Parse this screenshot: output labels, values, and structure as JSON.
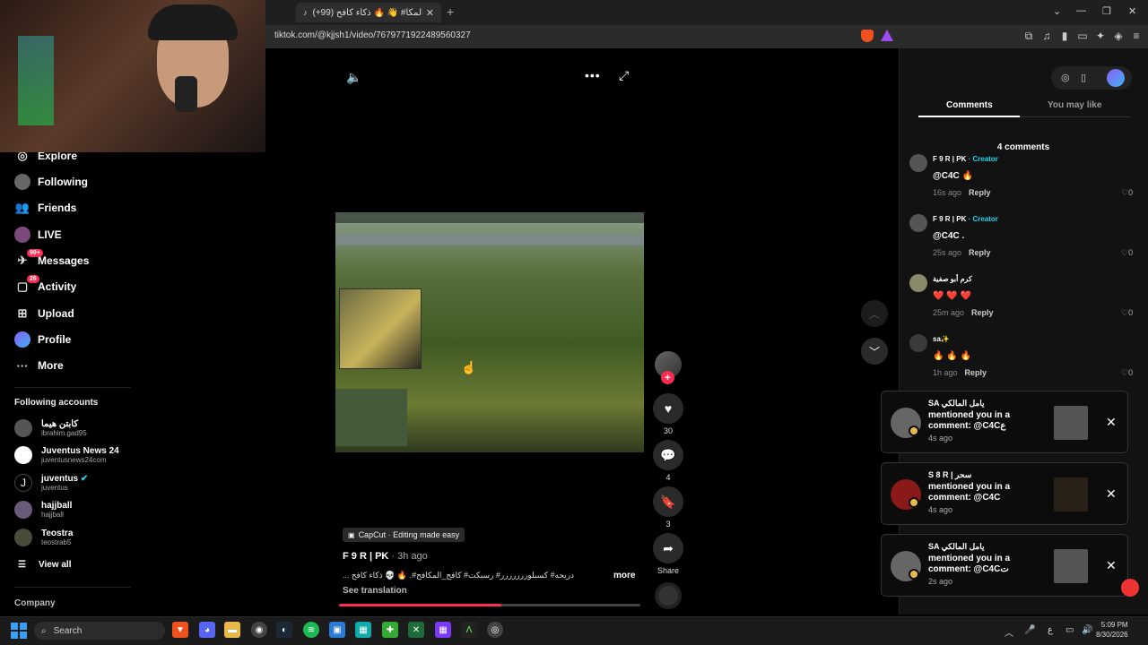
{
  "browser": {
    "tab_title": "كافح المكا# 👋 🔥 ذكاء كافح (99+)",
    "tab_favicon": "tiktok-icon",
    "url": "tiktok.com/@kjjsh1/video/7679771922489560327"
  },
  "sidebar": {
    "nav": [
      {
        "label": "Explore",
        "icon": "explore-icon"
      },
      {
        "label": "Following",
        "icon": "following-avatar-icon"
      },
      {
        "label": "Friends",
        "icon": "friends-icon"
      },
      {
        "label": "LIVE",
        "icon": "live-icon"
      },
      {
        "label": "Messages",
        "icon": "messages-icon",
        "badge": "99+"
      },
      {
        "label": "Activity",
        "icon": "activity-icon",
        "badge": "26"
      },
      {
        "label": "Upload",
        "icon": "upload-icon"
      },
      {
        "label": "Profile",
        "icon": "profile-avatar-icon"
      },
      {
        "label": "More",
        "icon": "more-icon"
      }
    ],
    "following_title": "Following accounts",
    "accounts": [
      {
        "name": "كابتن هيما",
        "handle": "ibrahim.gad95"
      },
      {
        "name": "Juventus News 24",
        "handle": "juventusnews24com"
      },
      {
        "name": "juventus",
        "handle": "juventus",
        "verified": true
      },
      {
        "name": "hajjball",
        "handle": "hajjball"
      },
      {
        "name": "Teostra",
        "handle": "teostrab5"
      }
    ],
    "view_all": "View all",
    "company": "Company"
  },
  "video": {
    "capcut_label": "CapCut · Editing made easy",
    "author": "F 9 R | PK",
    "posted": " · 3h ago",
    "caption": "دريحه# كسبلوررررررر# رسبكت# كافح_المكافح#. 🔥 💀 ذكاء كافح ...",
    "more": "more",
    "see_translation": "See translation",
    "progress": 0.54,
    "likes": "30",
    "comments": "4",
    "saves": "3",
    "share": "Share"
  },
  "panel": {
    "tab_comments": "Comments",
    "tab_you_may_like": "You may like",
    "comment_count": "4 comments",
    "comments": [
      {
        "name": "F 9 R | PK",
        "creator": " · Creator",
        "text": "@C4C 🔥",
        "time": "16s ago",
        "reply": "Reply",
        "likes": "0"
      },
      {
        "name": "F 9 R | PK",
        "creator": " · Creator",
        "text": "@C4C .",
        "time": "25s ago",
        "reply": "Reply",
        "likes": "0"
      },
      {
        "name": "كرم أبو صفية",
        "creator": "",
        "text": "❤️ ❤️ ❤️",
        "time": "25m ago",
        "reply": "Reply",
        "likes": "0"
      },
      {
        "name": "sa✨",
        "creator": "",
        "text": "🔥 🔥 🔥",
        "time": "1h ago",
        "reply": "Reply",
        "likes": "0"
      }
    ]
  },
  "notifications": [
    {
      "name": "SA يامل المالكي",
      "msg": "mentioned you in a comment: @C4Cع",
      "time": "4s ago"
    },
    {
      "name": "S 8 R | سحر",
      "msg": "mentioned you in a comment: @C4C",
      "time": "4s ago"
    },
    {
      "name": "SA يامل المالكي",
      "msg": "mentioned you in a comment: @C4Cت",
      "time": "2s ago"
    }
  ],
  "taskbar": {
    "search": "Search",
    "time": "5:09 PM",
    "date": "8/30/2026",
    "lang": "ع"
  },
  "colors": {
    "accent": "#fe2c55",
    "creator": "#20d5ec"
  }
}
